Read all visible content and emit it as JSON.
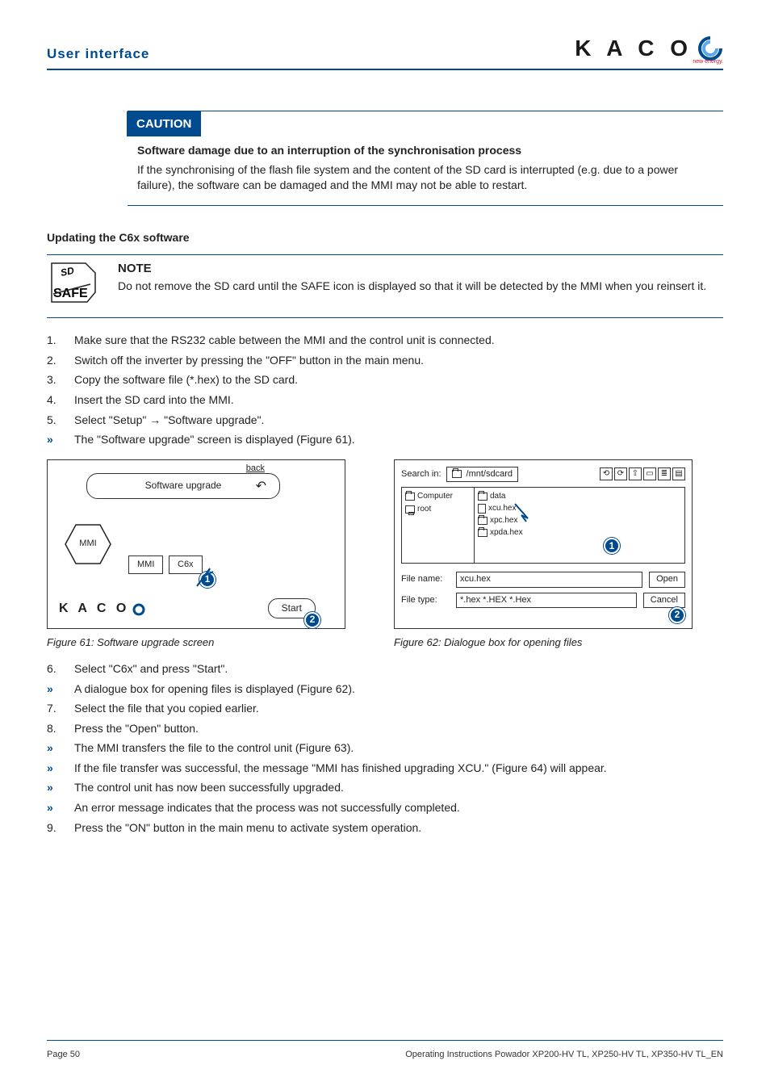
{
  "header": {
    "section": "User interface",
    "logo": "K A C O",
    "logo_sub": "new energy."
  },
  "caution": {
    "bar": "CAUTION",
    "title": "Software damage due to an interruption of the synchronisation process",
    "text": "If the synchronising of the flash file system and the content of the SD card is interrupted (e.g. due to a power failure), the software can be damaged and the MMI may not be able to restart."
  },
  "update_heading": "Updating the C6x software",
  "note": {
    "title": "NOTE",
    "text": "Do not remove the SD card until the SAFE icon is displayed so that it will be detected by the MMI when you reinsert it.",
    "icon_sd": "SD",
    "icon_safe": "SAFE"
  },
  "steps1": [
    {
      "n": "1.",
      "t": "Make sure that the RS232 cable between the MMI and the control unit is connected."
    },
    {
      "n": "2.",
      "t": "Switch off the inverter by pressing the \"OFF\" button in the main menu."
    },
    {
      "n": "3.",
      "t": "Copy the software file (*.hex) to the SD card."
    },
    {
      "n": "4.",
      "t": "Insert the SD card into the MMI."
    },
    {
      "n": "5.",
      "t": "Select \"Setup\" → \"Software upgrade\"."
    },
    {
      "n": "»",
      "t": "The \"Software upgrade\" screen is displayed (Figure 61).",
      "chev": true
    }
  ],
  "fig61": {
    "title": "Software upgrade",
    "back": "back",
    "hex": "MMI",
    "btn_mmi": "MMI",
    "btn_c6x": "C6x",
    "start": "Start",
    "brand": "K A C O",
    "callout1": "1",
    "callout2": "2",
    "caption": "Figure 61:  Software upgrade screen"
  },
  "fig62": {
    "searchin_lbl": "Search in:",
    "searchin_val": "/mnt/sdcard",
    "tree_computer": "Computer",
    "tree_root": "root",
    "files": {
      "data": "data",
      "xcu": "xcu.hex",
      "xpc": "xpc.hex",
      "xpda": "xpda.hex"
    },
    "filename_lbl": "File name:",
    "filename_val": "xcu.hex",
    "filetype_lbl": "File type:",
    "filetype_val": "*.hex *.HEX *.Hex",
    "open": "Open",
    "cancel": "Cancel",
    "callout1": "1",
    "callout2": "2",
    "caption": "Figure 62: Dialogue box for opening files"
  },
  "steps2": [
    {
      "n": "6.",
      "t": "Select \"C6x\" and press \"Start\"."
    },
    {
      "n": "»",
      "t": "A dialogue box for opening files is displayed (Figure 62).",
      "chev": true
    },
    {
      "n": "7.",
      "t": "Select the file that you copied earlier."
    },
    {
      "n": "8.",
      "t": "Press the \"Open\" button."
    },
    {
      "n": "»",
      "t": "The MMI transfers the file to the control unit (Figure 63).",
      "chev": true
    },
    {
      "n": "»",
      "t": "If the file transfer was successful, the message \"MMI has finished upgrading XCU.\" (Figure 64) will appear.",
      "chev": true
    },
    {
      "n": "»",
      "t": "The control unit has now been successfully upgraded.",
      "chev": true
    },
    {
      "n": "»",
      "t": "An error message indicates that the process was not successfully completed.",
      "chev": true
    },
    {
      "n": "9.",
      "t": "Press the \"ON\" button in the main menu to activate system operation."
    }
  ],
  "footer": {
    "page": "Page 50",
    "doc": "Operating Instructions Powador XP200-HV TL, XP250-HV TL, XP350-HV TL_EN"
  }
}
